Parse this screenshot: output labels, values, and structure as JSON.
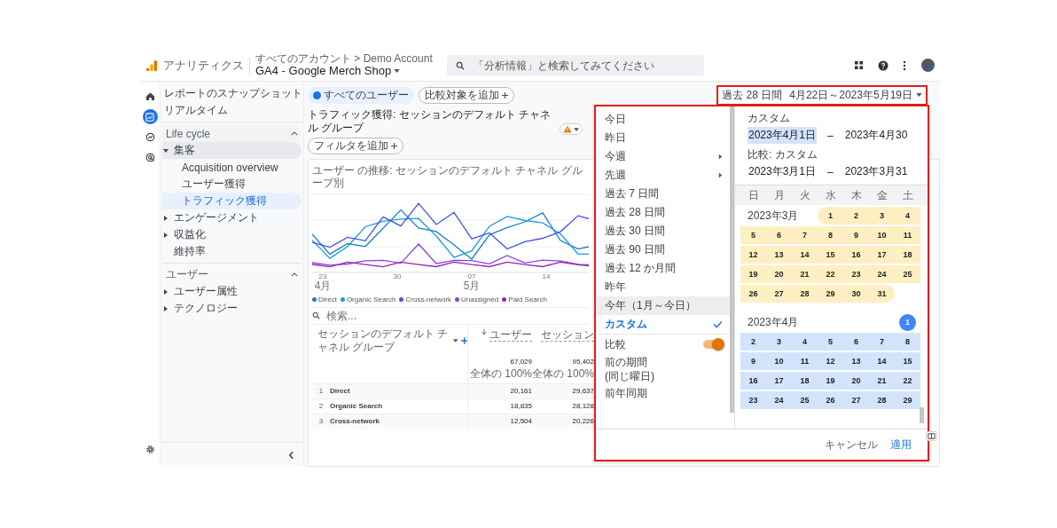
{
  "topbar": {
    "product": "アナリティクス",
    "breadcrumb": "すべてのアカウント > Demo Account",
    "property": "GA4 - Google Merch Shop",
    "search": {
      "placeholder": "「分析情報」と検索してみてください"
    }
  },
  "nav_rail": [
    {
      "kind": "home",
      "selected": false
    },
    {
      "kind": "reports",
      "selected": true
    },
    {
      "kind": "explore",
      "selected": false
    },
    {
      "kind": "advertising",
      "selected": false
    }
  ],
  "sidebar": {
    "items": [
      {
        "label": "レポートのスナップショット",
        "selected": false
      },
      {
        "label": "リアルタイム",
        "selected": false
      }
    ],
    "sections": [
      {
        "title": "Life cycle",
        "expanded": true,
        "items": [
          {
            "label": "集客",
            "expanded": true,
            "selected": false,
            "children": [
              {
                "label": "Acquisition overview",
                "selected": false
              },
              {
                "label": "ユーザー獲得",
                "selected": false
              },
              {
                "label": "トラフィック獲得",
                "selected": true
              }
            ]
          },
          {
            "label": "エンゲージメント",
            "expanded": false,
            "selected": false
          },
          {
            "label": "収益化",
            "expanded": false,
            "selected": false
          },
          {
            "label": "維持率",
            "selected": false
          }
        ]
      },
      {
        "title": "ユーザー",
        "expanded": true,
        "items": [
          {
            "label": "ユーザー属性",
            "expanded": false,
            "selected": false
          },
          {
            "label": "テクノロジー",
            "expanded": false,
            "selected": false
          }
        ]
      }
    ]
  },
  "comparisons": [
    {
      "kind": "segment",
      "label": "すべてのユーザー"
    },
    {
      "kind": "add",
      "label": "比較対象を追加"
    }
  ],
  "date_button": {
    "label": "過去 28 日間",
    "range": "4月22日～2023年5月19日"
  },
  "page_title": "トラフィック獲得: セッションのデフォルト チャネル グループ",
  "filter_chip": "フィルタを追加",
  "chart": {
    "title": "ユーザー の推移: セッションのデフォルト チャネル グループ別",
    "x_labels": [
      {
        "day": "23",
        "month": "4月"
      },
      {
        "day": "30"
      },
      {
        "day": "07",
        "month": "5月"
      },
      {
        "day": "14"
      }
    ],
    "legend": [
      {
        "label": "Direct",
        "color": "#1a7fc1"
      },
      {
        "label": "Organic Search",
        "color": "#1a9be0"
      },
      {
        "label": "Cross-network",
        "color": "#3f51e8"
      },
      {
        "label": "Unassigned",
        "color": "#8a3ff0"
      },
      {
        "label": "Paid Search",
        "color": "#9c1fb0"
      }
    ]
  },
  "table": {
    "search": {
      "placeholder": "検索..."
    },
    "columns": [
      {
        "kind": "dimension",
        "label": "セッションのデフォルト チャネル グループ"
      },
      {
        "kind": "metric",
        "label": "ユーザー",
        "sorted": true
      },
      {
        "kind": "metric",
        "label": "セッション",
        "sorted": false
      }
    ],
    "totals": [
      {
        "value": "67,029",
        "share": "全体の 100%"
      },
      {
        "value": "95,402",
        "share": "全体の 100%"
      }
    ],
    "rows": [
      {
        "rank": "1",
        "channel": "Direct",
        "values": [
          "20,161",
          "29,637"
        ]
      },
      {
        "rank": "2",
        "channel": "Organic Search",
        "values": [
          "18,835",
          "28,128"
        ]
      },
      {
        "rank": "3",
        "channel": "Cross-network",
        "values": [
          "12,504",
          "20,226"
        ]
      }
    ]
  },
  "date_picker": {
    "presets": [
      {
        "kind": "preset",
        "label": "今日",
        "selected": false,
        "highlighted": false
      },
      {
        "kind": "preset",
        "label": "昨日",
        "selected": false,
        "highlighted": false
      },
      {
        "kind": "submenu",
        "label": "今週",
        "selected": false,
        "highlighted": false
      },
      {
        "kind": "submenu",
        "label": "先週",
        "selected": false,
        "highlighted": false
      },
      {
        "kind": "preset",
        "label": "過去 7 日間",
        "selected": false,
        "highlighted": false
      },
      {
        "kind": "preset",
        "label": "過去 28 日間",
        "selected": false,
        "highlighted": false
      },
      {
        "kind": "preset",
        "label": "過去 30 日間",
        "selected": false,
        "highlighted": false
      },
      {
        "kind": "preset",
        "label": "過去 90 日間",
        "selected": false,
        "highlighted": false
      },
      {
        "kind": "preset",
        "label": "過去 12 か月間",
        "selected": false,
        "highlighted": false
      },
      {
        "kind": "preset",
        "label": "昨年",
        "selected": false,
        "highlighted": false
      },
      {
        "kind": "preset",
        "label": "今年（1月～今日）",
        "selected": false,
        "highlighted": true
      },
      {
        "kind": "preset",
        "label": "カスタム",
        "selected": true,
        "highlighted": false
      }
    ],
    "compare": {
      "label": "比較",
      "on": true
    },
    "compare_options": [
      {
        "label": "前の期間\n(同じ曜日)"
      },
      {
        "label": "前年同期"
      }
    ],
    "range": {
      "label": "カスタム",
      "start": "2023年4月1日",
      "separator": "–",
      "end": "2023年4月30"
    },
    "compare_range": {
      "label": "比較: カスタム",
      "start": "2023年3月1日",
      "separator": "–",
      "end": "2023年3月31"
    },
    "weekdays": [
      "日",
      "月",
      "火",
      "水",
      "木",
      "金",
      "土"
    ],
    "months": [
      {
        "label": "2023年3月",
        "kind": "compare",
        "start_marked": false,
        "weeks": [
          [
            "1",
            "2",
            "3",
            "4"
          ],
          [
            "5",
            "6",
            "7",
            "8",
            "9",
            "10",
            "11"
          ],
          [
            "12",
            "13",
            "14",
            "15",
            "16",
            "17",
            "18"
          ],
          [
            "19",
            "20",
            "21",
            "22",
            "23",
            "24",
            "25"
          ],
          [
            "26",
            "27",
            "28",
            "29",
            "30",
            "31"
          ]
        ]
      },
      {
        "label": "2023年4月",
        "kind": "primary",
        "start_marked": true,
        "weeks": [
          [
            "1"
          ],
          [
            "2",
            "3",
            "4",
            "5",
            "6",
            "7",
            "8"
          ],
          [
            "9",
            "10",
            "11",
            "12",
            "13",
            "14",
            "15"
          ],
          [
            "16",
            "17",
            "18",
            "19",
            "20",
            "21",
            "22"
          ],
          [
            "23",
            "24",
            "25",
            "26",
            "27",
            "28",
            "29"
          ]
        ]
      }
    ],
    "buttons": {
      "cancel": "キャンセル",
      "apply": "適用"
    }
  }
}
